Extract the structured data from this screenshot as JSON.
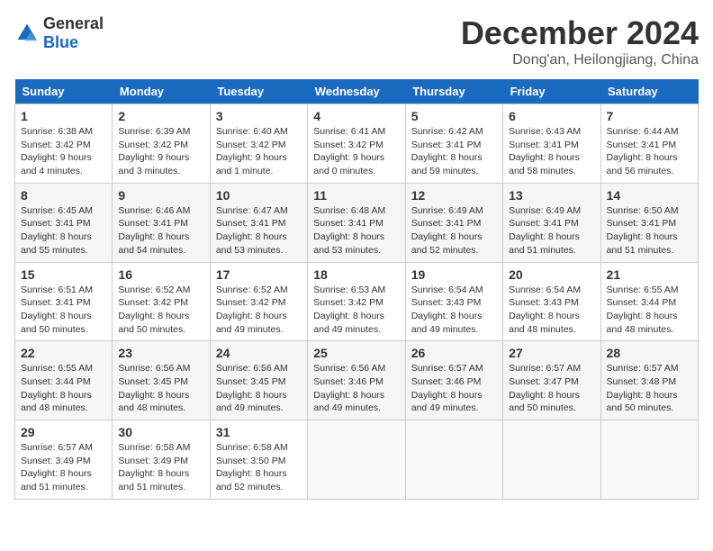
{
  "header": {
    "logo_general": "General",
    "logo_blue": "Blue",
    "month_title": "December 2024",
    "location": "Dong'an, Heilongjiang, China"
  },
  "weekdays": [
    "Sunday",
    "Monday",
    "Tuesday",
    "Wednesday",
    "Thursday",
    "Friday",
    "Saturday"
  ],
  "weeks": [
    [
      {
        "day": "1",
        "sunrise": "6:38 AM",
        "sunset": "3:42 PM",
        "daylight": "9 hours and 4 minutes."
      },
      {
        "day": "2",
        "sunrise": "6:39 AM",
        "sunset": "3:42 PM",
        "daylight": "9 hours and 3 minutes."
      },
      {
        "day": "3",
        "sunrise": "6:40 AM",
        "sunset": "3:42 PM",
        "daylight": "9 hours and 1 minute."
      },
      {
        "day": "4",
        "sunrise": "6:41 AM",
        "sunset": "3:42 PM",
        "daylight": "9 hours and 0 minutes."
      },
      {
        "day": "5",
        "sunrise": "6:42 AM",
        "sunset": "3:41 PM",
        "daylight": "8 hours and 59 minutes."
      },
      {
        "day": "6",
        "sunrise": "6:43 AM",
        "sunset": "3:41 PM",
        "daylight": "8 hours and 58 minutes."
      },
      {
        "day": "7",
        "sunrise": "6:44 AM",
        "sunset": "3:41 PM",
        "daylight": "8 hours and 56 minutes."
      }
    ],
    [
      {
        "day": "8",
        "sunrise": "6:45 AM",
        "sunset": "3:41 PM",
        "daylight": "8 hours and 55 minutes."
      },
      {
        "day": "9",
        "sunrise": "6:46 AM",
        "sunset": "3:41 PM",
        "daylight": "8 hours and 54 minutes."
      },
      {
        "day": "10",
        "sunrise": "6:47 AM",
        "sunset": "3:41 PM",
        "daylight": "8 hours and 53 minutes."
      },
      {
        "day": "11",
        "sunrise": "6:48 AM",
        "sunset": "3:41 PM",
        "daylight": "8 hours and 53 minutes."
      },
      {
        "day": "12",
        "sunrise": "6:49 AM",
        "sunset": "3:41 PM",
        "daylight": "8 hours and 52 minutes."
      },
      {
        "day": "13",
        "sunrise": "6:49 AM",
        "sunset": "3:41 PM",
        "daylight": "8 hours and 51 minutes."
      },
      {
        "day": "14",
        "sunrise": "6:50 AM",
        "sunset": "3:41 PM",
        "daylight": "8 hours and 51 minutes."
      }
    ],
    [
      {
        "day": "15",
        "sunrise": "6:51 AM",
        "sunset": "3:41 PM",
        "daylight": "8 hours and 50 minutes."
      },
      {
        "day": "16",
        "sunrise": "6:52 AM",
        "sunset": "3:42 PM",
        "daylight": "8 hours and 50 minutes."
      },
      {
        "day": "17",
        "sunrise": "6:52 AM",
        "sunset": "3:42 PM",
        "daylight": "8 hours and 49 minutes."
      },
      {
        "day": "18",
        "sunrise": "6:53 AM",
        "sunset": "3:42 PM",
        "daylight": "8 hours and 49 minutes."
      },
      {
        "day": "19",
        "sunrise": "6:54 AM",
        "sunset": "3:43 PM",
        "daylight": "8 hours and 49 minutes."
      },
      {
        "day": "20",
        "sunrise": "6:54 AM",
        "sunset": "3:43 PM",
        "daylight": "8 hours and 48 minutes."
      },
      {
        "day": "21",
        "sunrise": "6:55 AM",
        "sunset": "3:44 PM",
        "daylight": "8 hours and 48 minutes."
      }
    ],
    [
      {
        "day": "22",
        "sunrise": "6:55 AM",
        "sunset": "3:44 PM",
        "daylight": "8 hours and 48 minutes."
      },
      {
        "day": "23",
        "sunrise": "6:56 AM",
        "sunset": "3:45 PM",
        "daylight": "8 hours and 48 minutes."
      },
      {
        "day": "24",
        "sunrise": "6:56 AM",
        "sunset": "3:45 PM",
        "daylight": "8 hours and 49 minutes."
      },
      {
        "day": "25",
        "sunrise": "6:56 AM",
        "sunset": "3:46 PM",
        "daylight": "8 hours and 49 minutes."
      },
      {
        "day": "26",
        "sunrise": "6:57 AM",
        "sunset": "3:46 PM",
        "daylight": "8 hours and 49 minutes."
      },
      {
        "day": "27",
        "sunrise": "6:57 AM",
        "sunset": "3:47 PM",
        "daylight": "8 hours and 50 minutes."
      },
      {
        "day": "28",
        "sunrise": "6:57 AM",
        "sunset": "3:48 PM",
        "daylight": "8 hours and 50 minutes."
      }
    ],
    [
      {
        "day": "29",
        "sunrise": "6:57 AM",
        "sunset": "3:49 PM",
        "daylight": "8 hours and 51 minutes."
      },
      {
        "day": "30",
        "sunrise": "6:58 AM",
        "sunset": "3:49 PM",
        "daylight": "8 hours and 51 minutes."
      },
      {
        "day": "31",
        "sunrise": "6:58 AM",
        "sunset": "3:50 PM",
        "daylight": "8 hours and 52 minutes."
      },
      null,
      null,
      null,
      null
    ]
  ]
}
